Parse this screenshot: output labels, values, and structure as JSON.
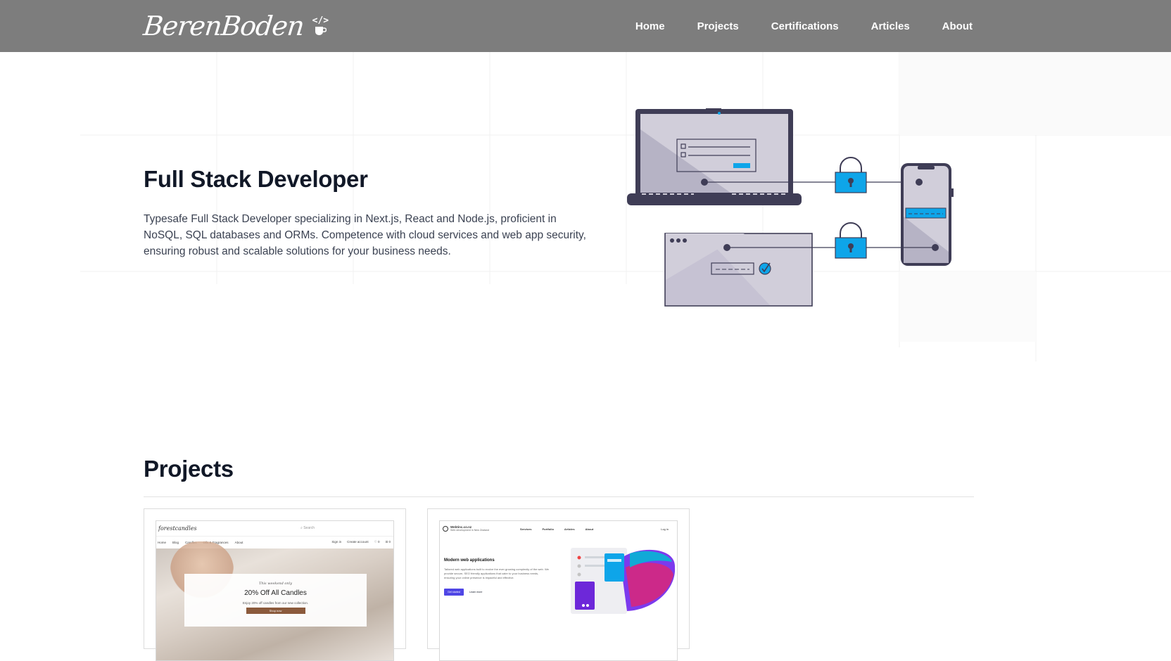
{
  "header": {
    "logo_text": "BerenBoden",
    "logo_code_glyph": "</>",
    "logo_icon": "coffee-cup-icon",
    "nav": [
      {
        "label": "Home"
      },
      {
        "label": "Projects"
      },
      {
        "label": "Certifications"
      },
      {
        "label": "Articles"
      },
      {
        "label": "About"
      }
    ]
  },
  "hero": {
    "title": "Full Stack Developer",
    "description": "Typesafe Full Stack Developer specializing in Next.js, React and Node.js, proficient in NoSQL, SQL databases and ORMs. Competence with cloud services and web app security, ensuring robust and scalable solutions for your business needs.",
    "illustration": "secure-devices-illustration"
  },
  "projects": {
    "title": "Projects",
    "cards": [
      {
        "preview": {
          "brand": "forestcandles",
          "search_placeholder": "Search",
          "nav": [
            "Home",
            "Blog",
            "Candles",
            "Oils & Fragrances",
            "About"
          ],
          "nav_right": [
            "Sign in",
            "Create account"
          ],
          "kicker": "This weekend only",
          "offer": "20% Off All Candles",
          "sub": "Enjoy 20% off candles from our new collection.",
          "button": "Shop now"
        }
      },
      {
        "preview": {
          "brand": "Webtinc.co.nz",
          "tagline": "Web development in New Zealand",
          "nav": [
            "Services",
            "Portfolio",
            "Articles",
            "About"
          ],
          "login": "Log in",
          "headline": "Modern web applications",
          "body": "Tailored web applications built to evolve the ever-growing complexity of the web. We provide secure, SEO friendly applications that cater to your business needs, ensuring your online presence is impactful and effective.",
          "primary_button": "Get started",
          "secondary_link": "Learn more"
        }
      }
    ]
  },
  "colors": {
    "header_bg": "#7d7d7d",
    "accent_blue": "#0ea5e9",
    "device_dark": "#3f3d56",
    "device_fill": "#d1ceda"
  }
}
